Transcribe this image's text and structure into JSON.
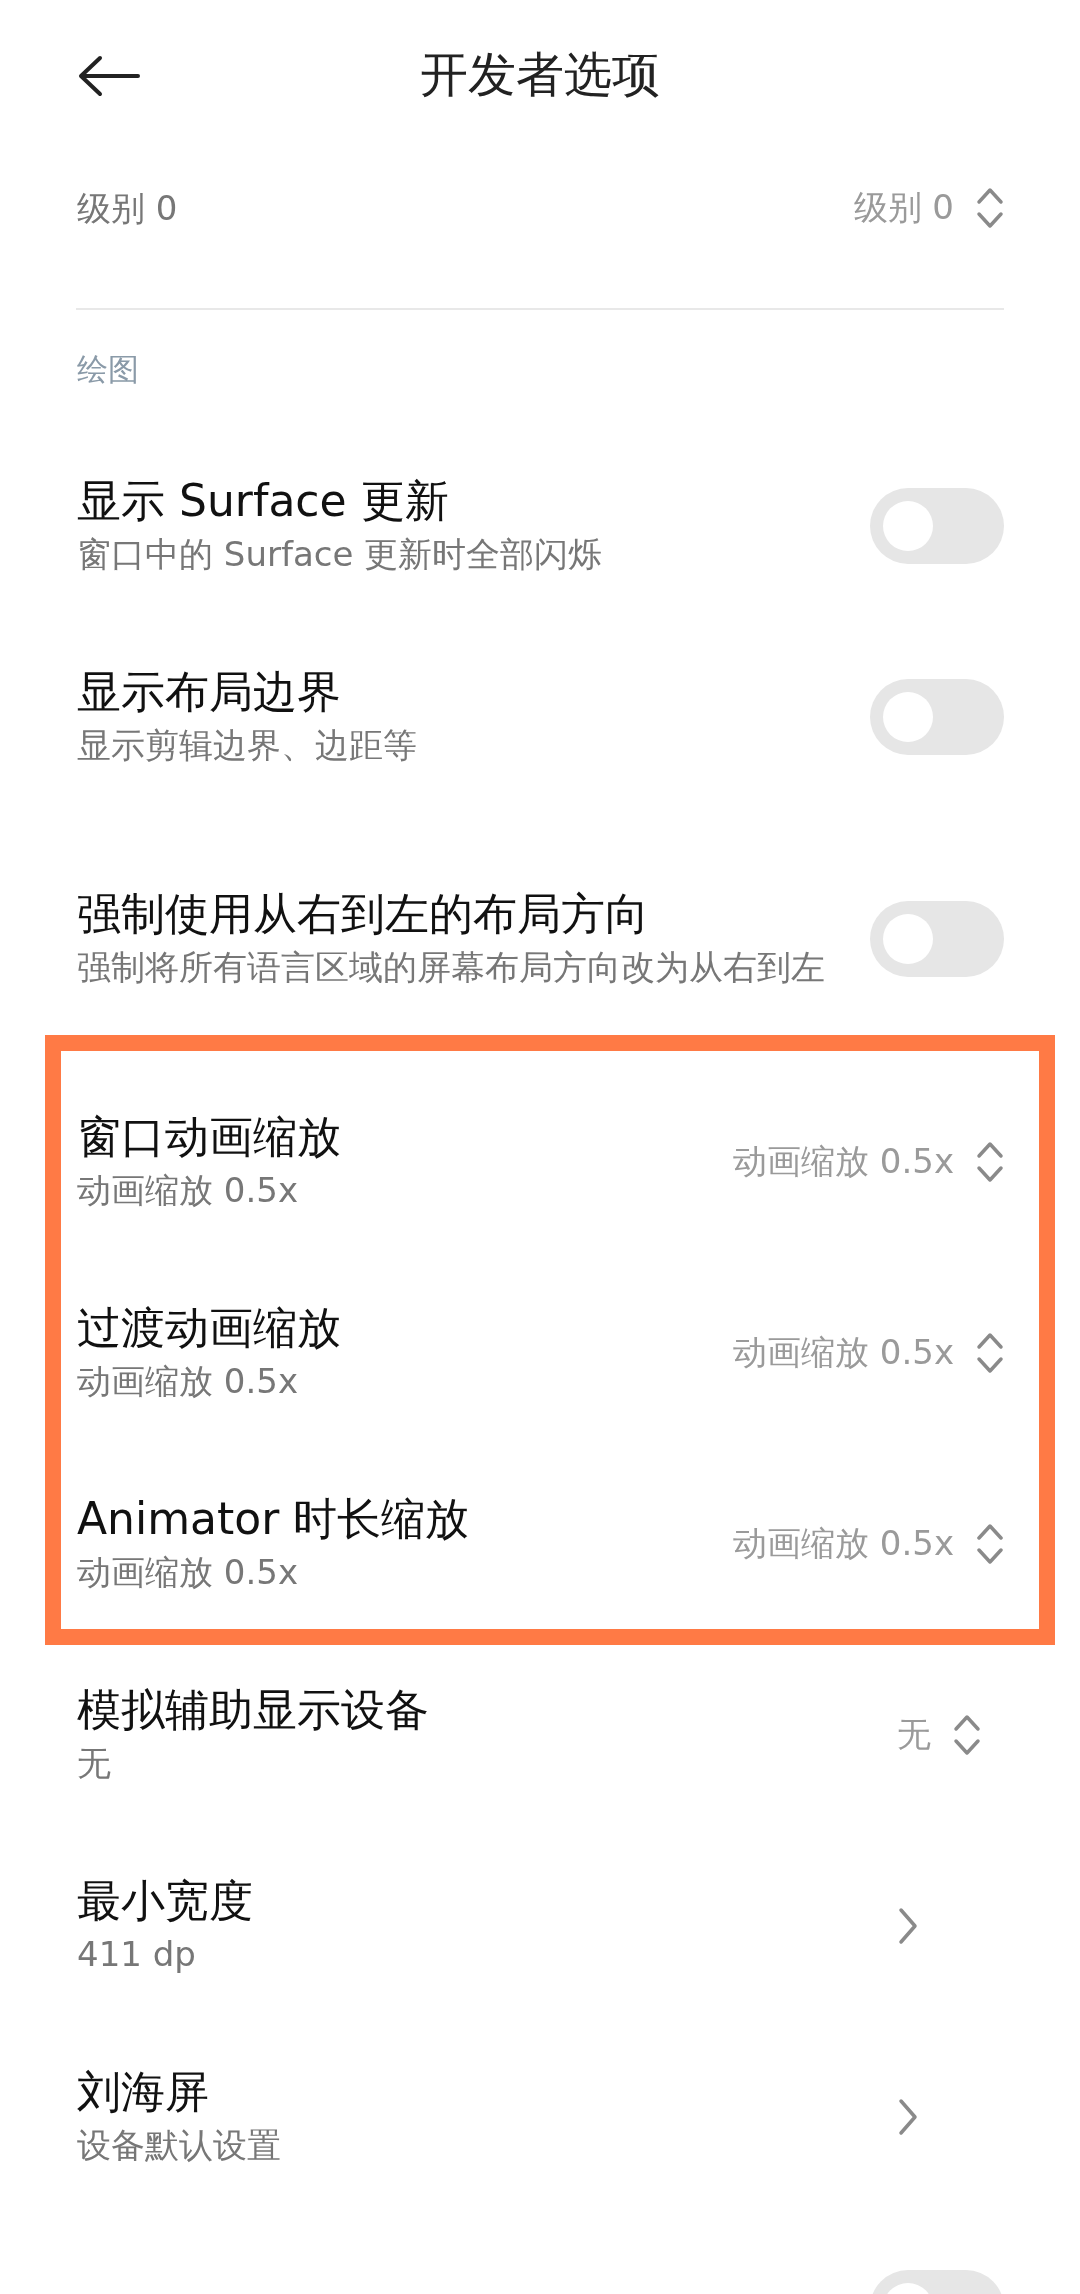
{
  "header": {
    "title": "开发者选项"
  },
  "top_item": {
    "kind": "select",
    "subtitle": "级别 0",
    "value": "级别 0"
  },
  "sections": [
    {
      "label": "绘图",
      "groups": [
        {
          "highlighted": false,
          "items": [
            {
              "kind": "toggle",
              "title": "显示 Surface 更新",
              "subtitle": "窗口中的 Surface 更新时全部闪烁",
              "on": false
            },
            {
              "kind": "toggle",
              "title": "显示布局边界",
              "subtitle": "显示剪辑边界、边距等",
              "on": false
            },
            {
              "kind": "toggle",
              "title": "强制使用从右到左的布局方向",
              "subtitle": "强制将所有语言区域的屏幕布局方向改为从右到左",
              "on": false
            }
          ]
        },
        {
          "highlighted": true,
          "items": [
            {
              "kind": "select",
              "title": "窗口动画缩放",
              "subtitle": "动画缩放 0.5x",
              "value": "动画缩放 0.5x"
            },
            {
              "kind": "select",
              "title": "过渡动画缩放",
              "subtitle": "动画缩放 0.5x",
              "value": "动画缩放 0.5x"
            },
            {
              "kind": "select",
              "title": "Animator 时长缩放",
              "subtitle": "动画缩放 0.5x",
              "value": "动画缩放 0.5x"
            }
          ]
        },
        {
          "highlighted": false,
          "items": [
            {
              "kind": "select",
              "title": "模拟辅助显示设备",
              "subtitle": "无",
              "value": "无"
            },
            {
              "kind": "link",
              "title": "最小宽度",
              "subtitle": "411 dp"
            },
            {
              "kind": "link",
              "title": "刘海屏",
              "subtitle": "设备默认设置"
            },
            {
              "kind": "toggle",
              "on": false
            }
          ]
        }
      ]
    }
  ]
}
